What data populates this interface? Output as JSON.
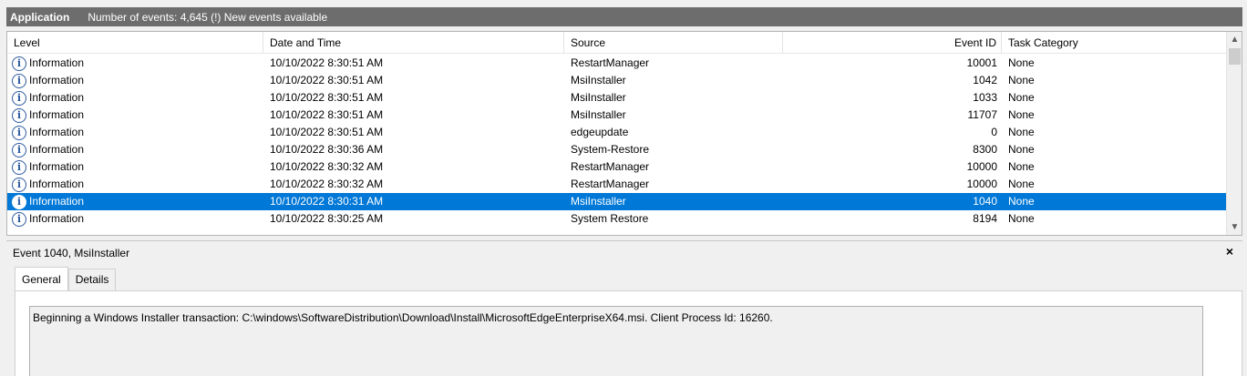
{
  "titlebar": {
    "app": "Application",
    "summary": "Number of events: 4,645 (!) New events available"
  },
  "grid": {
    "columns": {
      "level": "Level",
      "date": "Date and Time",
      "source": "Source",
      "event_id": "Event ID",
      "task": "Task Category"
    },
    "rows": [
      {
        "level": "Information",
        "date": "10/10/2022 8:30:51 AM",
        "source": "RestartManager",
        "event_id": "10001",
        "task": "None"
      },
      {
        "level": "Information",
        "date": "10/10/2022 8:30:51 AM",
        "source": "MsiInstaller",
        "event_id": "1042",
        "task": "None"
      },
      {
        "level": "Information",
        "date": "10/10/2022 8:30:51 AM",
        "source": "MsiInstaller",
        "event_id": "1033",
        "task": "None"
      },
      {
        "level": "Information",
        "date": "10/10/2022 8:30:51 AM",
        "source": "MsiInstaller",
        "event_id": "11707",
        "task": "None"
      },
      {
        "level": "Information",
        "date": "10/10/2022 8:30:51 AM",
        "source": "edgeupdate",
        "event_id": "0",
        "task": "None"
      },
      {
        "level": "Information",
        "date": "10/10/2022 8:30:36 AM",
        "source": "System-Restore",
        "event_id": "8300",
        "task": "None"
      },
      {
        "level": "Information",
        "date": "10/10/2022 8:30:32 AM",
        "source": "RestartManager",
        "event_id": "10000",
        "task": "None"
      },
      {
        "level": "Information",
        "date": "10/10/2022 8:30:32 AM",
        "source": "RestartManager",
        "event_id": "10000",
        "task": "None"
      },
      {
        "level": "Information",
        "date": "10/10/2022 8:30:31 AM",
        "source": "MsiInstaller",
        "event_id": "1040",
        "task": "None",
        "selected": true
      },
      {
        "level": "Information",
        "date": "10/10/2022 8:30:25 AM",
        "source": "System Restore",
        "event_id": "8194",
        "task": "None"
      }
    ],
    "scroll": {
      "up_icon": "▲",
      "down_icon": "▼"
    }
  },
  "detail": {
    "title": "Event 1040, MsiInstaller",
    "close": "×",
    "tabs": [
      "General",
      "Details"
    ],
    "message": "Beginning a Windows Installer transaction: C:\\windows\\SoftwareDistribution\\Download\\Install\\MicrosoftEdgeEnterpriseX64.msi. Client Process Id: 16260."
  },
  "colors": {
    "selection": "#0078d7",
    "titlebar": "#6d6d6d",
    "info_icon": "#2c5aa0"
  },
  "icons": {
    "info": "i"
  }
}
